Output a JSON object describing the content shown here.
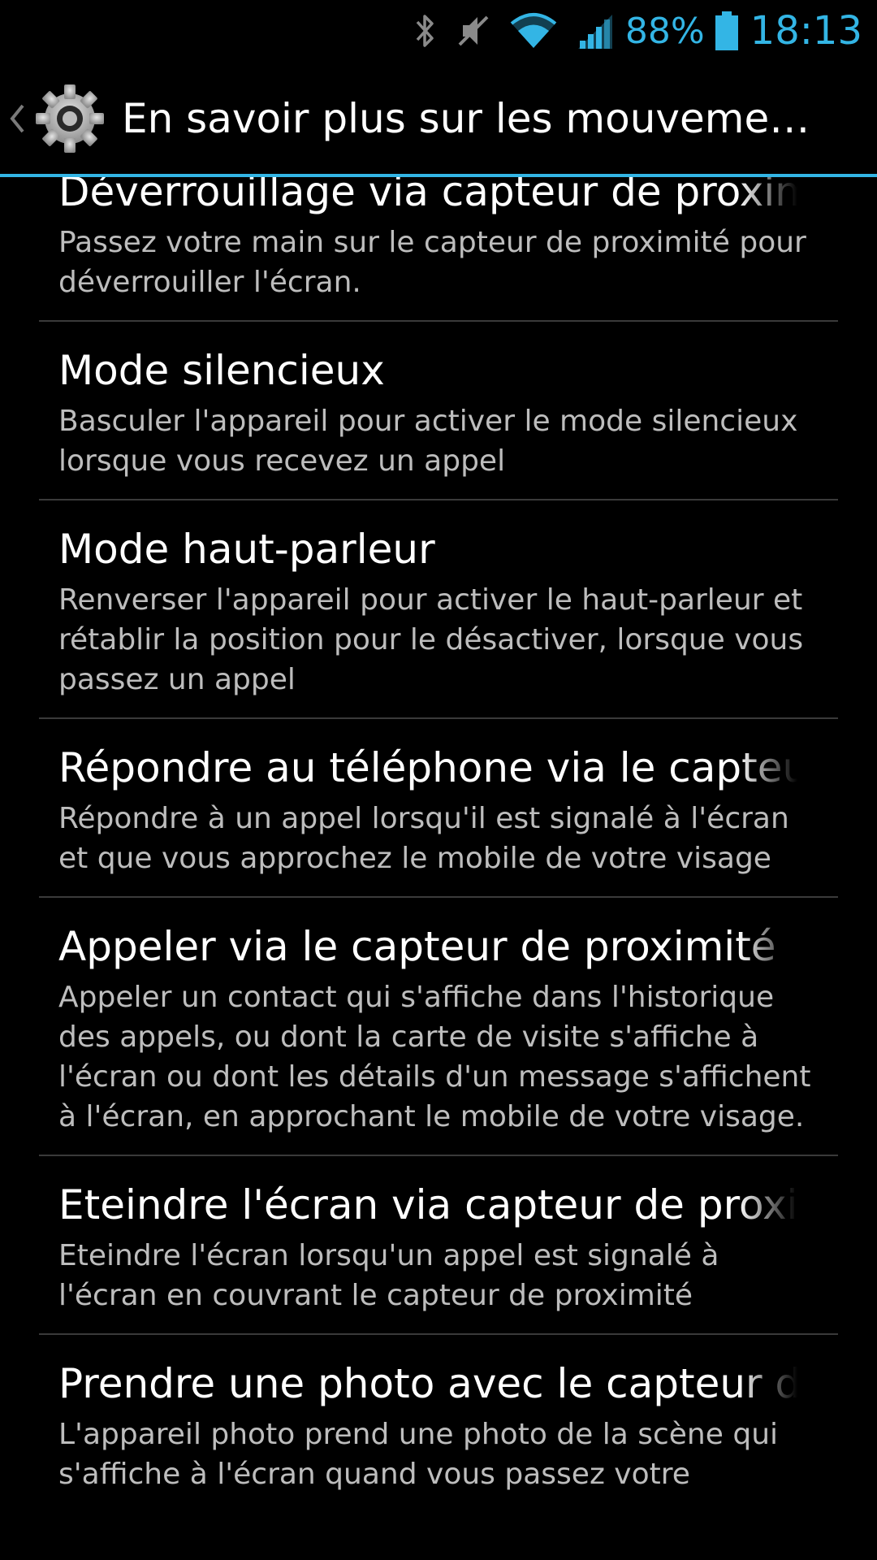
{
  "status_bar": {
    "battery_percent": "88%",
    "time": "18:13",
    "icons": [
      "bluetooth-icon",
      "mute-icon",
      "wifi-icon",
      "signal-icon",
      "battery-icon"
    ],
    "accent_color": "#33b5e5"
  },
  "action_bar": {
    "title": "En savoir plus sur les mouvements...",
    "icon": "gear-icon"
  },
  "settings": [
    {
      "title": "Déverrouillage via capteur de proximité",
      "summary": "Passez votre main sur le capteur de proximité pour déverrouiller l'écran."
    },
    {
      "title": "Mode silencieux",
      "summary": "Basculer l'appareil pour activer le mode silencieux lorsque vous recevez un appel"
    },
    {
      "title": "Mode haut-parleur",
      "summary": "Renverser l'appareil pour activer le haut-parleur et rétablir la position pour le désactiver, lorsque vous passez un appel"
    },
    {
      "title": "Répondre au téléphone via le capteur",
      "summary": "Répondre à un appel lorsqu'il est signalé à l'écran et que vous approchez le mobile de votre visage"
    },
    {
      "title": "Appeler via le capteur de proximité",
      "summary": "Appeler un contact qui s'affiche dans l'historique des appels, ou dont la carte de visite s'affiche à l'écran ou dont les détails d'un message s'affichent à l'écran, en approchant le mobile de votre visage."
    },
    {
      "title": "Eteindre l'écran via capteur de proximité",
      "summary": "Eteindre l'écran lorsqu'un appel est signalé à l'écran en couvrant le capteur de proximité"
    },
    {
      "title": "Prendre une photo avec le capteur de",
      "summary": "L'appareil photo prend une photo de la scène qui s'affiche à l'écran quand vous passez votre"
    }
  ]
}
